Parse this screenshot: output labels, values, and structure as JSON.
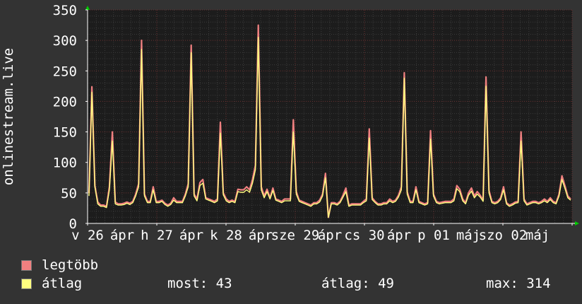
{
  "chart_data": {
    "type": "line",
    "ylabel": "onlinestream.live",
    "ylim": [
      0,
      350
    ],
    "yticks": [
      "0",
      "50",
      "100",
      "150",
      "200",
      "250",
      "300",
      "350"
    ],
    "grid": true,
    "xtick_labels": [
      "v 26",
      "ápr",
      "h 27",
      "ápr",
      "k 28",
      "ápr",
      "sze 29",
      "ápr",
      "cs 30",
      "ápr",
      "p 01",
      "máj",
      "szo 02",
      "máj"
    ],
    "series": [
      {
        "name": "legtöbb",
        "color": "#f08080",
        "values": [
          50,
          224,
          62,
          35,
          30,
          30,
          28,
          60,
          150,
          35,
          32,
          32,
          33,
          35,
          33,
          36,
          48,
          65,
          300,
          48,
          36,
          36,
          60,
          36,
          36,
          38,
          33,
          30,
          33,
          42,
          36,
          36,
          36,
          48,
          65,
          292,
          48,
          40,
          67,
          72,
          42,
          40,
          38,
          36,
          40,
          166,
          50,
          40,
          36,
          38,
          36,
          56,
          55,
          55,
          60,
          55,
          72,
          95,
          325,
          60,
          45,
          56,
          42,
          58,
          40,
          38,
          36,
          40,
          40,
          40,
          170,
          52,
          38,
          36,
          34,
          32,
          30,
          34,
          34,
          38,
          48,
          82,
          10,
          34,
          34,
          32,
          36,
          46,
          58,
          30,
          32,
          32,
          32,
          32,
          36,
          40,
          155,
          42,
          36,
          32,
          32,
          34,
          34,
          40,
          36,
          38,
          46,
          60,
          247,
          52,
          36,
          36,
          60,
          36,
          34,
          32,
          34,
          152,
          48,
          36,
          34,
          35,
          36,
          36,
          36,
          40,
          62,
          56,
          40,
          34,
          50,
          58,
          45,
          52,
          46,
          38,
          240,
          54,
          36,
          34,
          36,
          42,
          60,
          34,
          30,
          32,
          35,
          36,
          150,
          40,
          32,
          34,
          36,
          36,
          34,
          36,
          40,
          36,
          42,
          36,
          34,
          48,
          78,
          62,
          45,
          40
        ]
      },
      {
        "name": "átlag",
        "color": "#ffff80",
        "values": [
          45,
          215,
          60,
          32,
          28,
          28,
          26,
          55,
          135,
          32,
          30,
          30,
          31,
          33,
          31,
          34,
          45,
          60,
          285,
          45,
          34,
          34,
          55,
          34,
          34,
          36,
          31,
          28,
          31,
          38,
          34,
          34,
          34,
          45,
          60,
          280,
          45,
          37,
          62,
          66,
          40,
          38,
          36,
          34,
          37,
          148,
          47,
          37,
          34,
          36,
          34,
          52,
          51,
          51,
          55,
          51,
          66,
          88,
          305,
          55,
          42,
          52,
          40,
          54,
          38,
          36,
          34,
          37,
          37,
          37,
          150,
          48,
          36,
          34,
          32,
          30,
          28,
          32,
          32,
          35,
          45,
          75,
          10,
          32,
          32,
          30,
          34,
          43,
          52,
          28,
          30,
          30,
          30,
          30,
          34,
          37,
          140,
          39,
          34,
          30,
          30,
          32,
          32,
          37,
          34,
          36,
          43,
          55,
          238,
          48,
          34,
          34,
          55,
          34,
          32,
          30,
          32,
          138,
          45,
          34,
          32,
          33,
          34,
          34,
          34,
          37,
          57,
          52,
          37,
          32,
          46,
          53,
          42,
          48,
          43,
          36,
          225,
          50,
          34,
          32,
          34,
          39,
          55,
          32,
          28,
          30,
          33,
          34,
          135,
          37,
          30,
          32,
          34,
          34,
          32,
          34,
          37,
          34,
          39,
          34,
          32,
          45,
          72,
          58,
          42,
          38
        ]
      }
    ]
  },
  "legend": {
    "items": [
      {
        "label": "legtöbb",
        "color": "#f08080"
      },
      {
        "label": "átlag",
        "color": "#ffff80"
      }
    ]
  },
  "stats": {
    "current": "most: 43",
    "average": "átlag: 49",
    "max": "max: 314"
  }
}
